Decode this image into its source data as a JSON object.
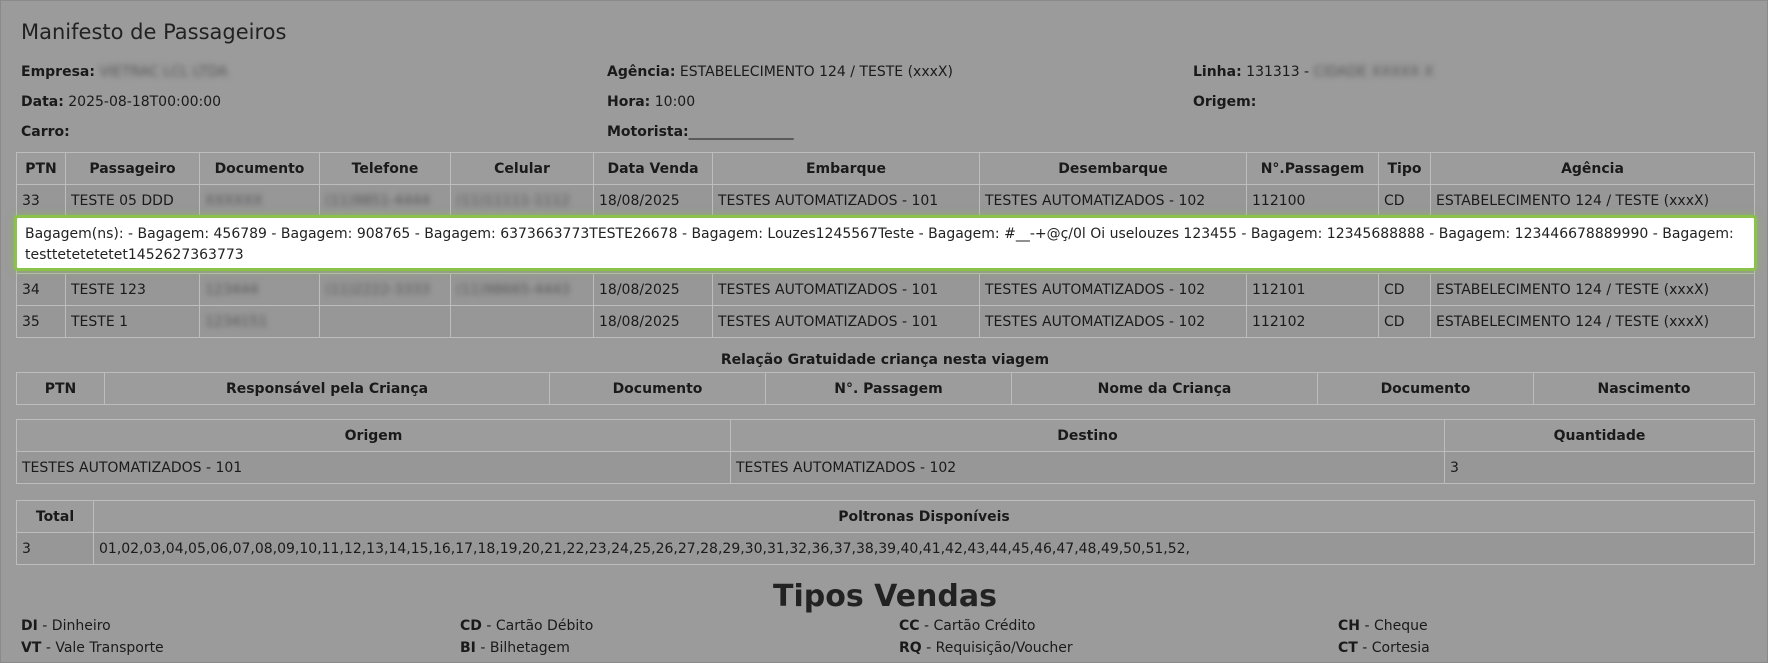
{
  "title": "Manifesto de Passageiros",
  "info": {
    "empresa_label": "Empresa:",
    "empresa_value": "VIETRAC LCL LTDA",
    "agencia_label": "Agência:",
    "agencia_value": "ESTABELECIMENTO 124 / TESTE (xxxX)",
    "linha_label": "Linha:",
    "linha_value": "131313 -",
    "linha_blur": "CIDADE XXXXX X",
    "data_label": "Data:",
    "data_value": "2025-08-18T00:00:00",
    "hora_label": "Hora:",
    "hora_value": "10:00",
    "origem_label": "Origem:",
    "carro_label": "Carro:",
    "motorista_label": "Motorista:",
    "motorista_value": "_______________"
  },
  "passengers": {
    "headers": [
      "PTN",
      "Passageiro",
      "Documento",
      "Telefone",
      "Celular",
      "Data Venda",
      "Embarque",
      "Desembarque",
      "N°.Passagem",
      "Tipo",
      "Agência"
    ],
    "rows": [
      [
        "33",
        "TESTE 05 DDD",
        "XXXXXX",
        "(11)9851-4444",
        "(11)11111-1112",
        "18/08/2025",
        "TESTES AUTOMATIZADOS - 101",
        "TESTES AUTOMATIZADOS - 102",
        "112100",
        "CD",
        "ESTABELECIMENTO 124 / TESTE (xxxX)"
      ],
      [
        "34",
        "TESTE 123",
        "123444",
        "(11)2222-3333",
        "(11)98665-4443",
        "18/08/2025",
        "TESTES AUTOMATIZADOS - 101",
        "TESTES AUTOMATIZADOS - 102",
        "112101",
        "CD",
        "ESTABELECIMENTO 124 / TESTE (xxxX)"
      ],
      [
        "35",
        "TESTE 1",
        "1234151",
        "",
        "",
        "18/08/2025",
        "TESTES AUTOMATIZADOS - 101",
        "TESTES AUTOMATIZADOS - 102",
        "112102",
        "CD",
        "ESTABELECIMENTO 124 / TESTE (xxxX)"
      ]
    ]
  },
  "baggage_text": "Bagagem(ns): - Bagagem: 456789 - Bagagem: 908765 - Bagagem: 6373663773TESTE26678 - Bagagem: Louzes1245567Teste - Bagagem: #__-+@ç/0l Oi uselouzes 123455 - Bagagem: 12345688888 - Bagagem: 123446678889990 - Bagagem: testtetetetetet1452627363773",
  "child_section": {
    "caption": "Relação Gratuidade criança nesta viagem",
    "headers": [
      "PTN",
      "Responsável pela Criança",
      "Documento",
      "N°. Passagem",
      "Nome da Criança",
      "Documento",
      "Nascimento"
    ]
  },
  "route": {
    "headers": [
      "Origem",
      "Destino",
      "Quantidade"
    ],
    "row": [
      "TESTES AUTOMATIZADOS - 101",
      "TESTES AUTOMATIZADOS - 102",
      "3"
    ]
  },
  "seats": {
    "headers": [
      "Total",
      "Poltronas Disponíveis"
    ],
    "row": [
      "3",
      "01,02,03,04,05,06,07,08,09,10,11,12,13,14,15,16,17,18,19,20,21,22,23,24,25,26,27,28,29,30,31,32,36,37,38,39,40,41,42,43,44,45,46,47,48,49,50,51,52,"
    ]
  },
  "tipos_vendas": {
    "title": "Tipos Vendas",
    "items": [
      {
        "code": "DI",
        "label": "- Dinheiro"
      },
      {
        "code": "CD",
        "label": "- Cartão Débito"
      },
      {
        "code": "CC",
        "label": "- Cartão Crédito"
      },
      {
        "code": "CH",
        "label": "- Cheque"
      },
      {
        "code": "VT",
        "label": "- Vale Transporte"
      },
      {
        "code": "BI",
        "label": "- Bilhetagem"
      },
      {
        "code": "RQ",
        "label": "- Requisição/Voucher"
      },
      {
        "code": "CT",
        "label": "- Cortesia"
      }
    ]
  }
}
